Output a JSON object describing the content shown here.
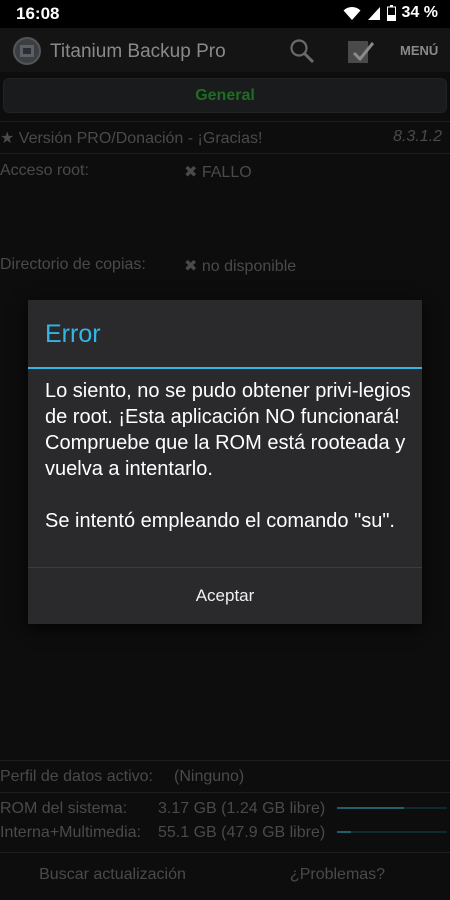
{
  "status_bar": {
    "time": "16:08",
    "battery_percent": "34 %",
    "icons": [
      "wifi-icon",
      "signal-icon",
      "battery-icon"
    ]
  },
  "action_bar": {
    "title": "Titanium Backup Pro",
    "menu_label": "MENÚ",
    "icons": [
      "app-logo-icon",
      "search-icon",
      "batch-check-icon"
    ]
  },
  "tabs": {
    "active": "General"
  },
  "info": {
    "version_label": "★ Versión PRO/Donación - ¡Gracias!",
    "version_number": "8.3.1.2",
    "root_access_label": "Acceso root:",
    "root_access_value": "✖ FALLO",
    "backup_dir_label": "Directorio de copias:",
    "backup_dir_value": "✖ no disponible"
  },
  "storage": {
    "profile_label": "Perfil de datos activo:",
    "profile_value": "(Ninguno)",
    "rom_label": "ROM del sistema:",
    "rom_value": "3.17 GB (1.24 GB libre)",
    "rom_used_fraction": 0.61,
    "internal_label": "Interna+Multimedia:",
    "internal_value": "55.1 GB (47.9 GB libre)",
    "internal_used_fraction": 0.13
  },
  "bottom_buttons": {
    "update": "Buscar actualización",
    "problems": "¿Problemas?"
  },
  "dialog": {
    "title": "Error",
    "message_1": "Lo siento, no se pudo obtener privi-legios de root. ¡Esta aplicación NO funcionará! Compruebe que la ROM está rooteada y vuelva a intentarlo.",
    "message_2": "Se intentó empleando el comando \"su\".",
    "accept_button": "Aceptar"
  },
  "colors": {
    "accent": "#33b5e5",
    "general_tab_text": "#1e6e22",
    "dialog_bg": "#2a2a2c"
  }
}
